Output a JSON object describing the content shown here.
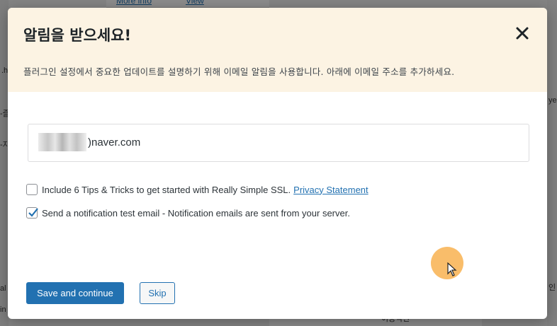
{
  "background": {
    "links": [
      "More info",
      "View"
    ],
    "fragments": [
      ".h",
      "-즐",
      "-지",
      "ye",
      "al",
      "in",
      "인",
      "이용약관"
    ]
  },
  "modal": {
    "title": "알림을 받으세요!",
    "description": "플러그인 설정에서 중요한 업데이트를 설명하기 위해 이메일 알림을 사용합니다. 아래에 이메일 주소를 추가하세요.",
    "email_value": ")naver.com",
    "options": {
      "tips_label": "Include 6 Tips & Tricks to get started with Really Simple SSL.",
      "tips_checked": false,
      "privacy_link": "Privacy Statement",
      "test_email_label": "Send a notification test email - Notification emails are sent from your server.",
      "test_email_checked": true
    },
    "buttons": {
      "save_label": "Save and continue",
      "skip_label": "Skip"
    },
    "colors": {
      "header_bg": "#fcf3e3",
      "primary": "#2271b1"
    }
  },
  "icons": {
    "close": "close-icon",
    "check": "checkmark-icon",
    "cursor": "mouse-pointer-icon"
  }
}
